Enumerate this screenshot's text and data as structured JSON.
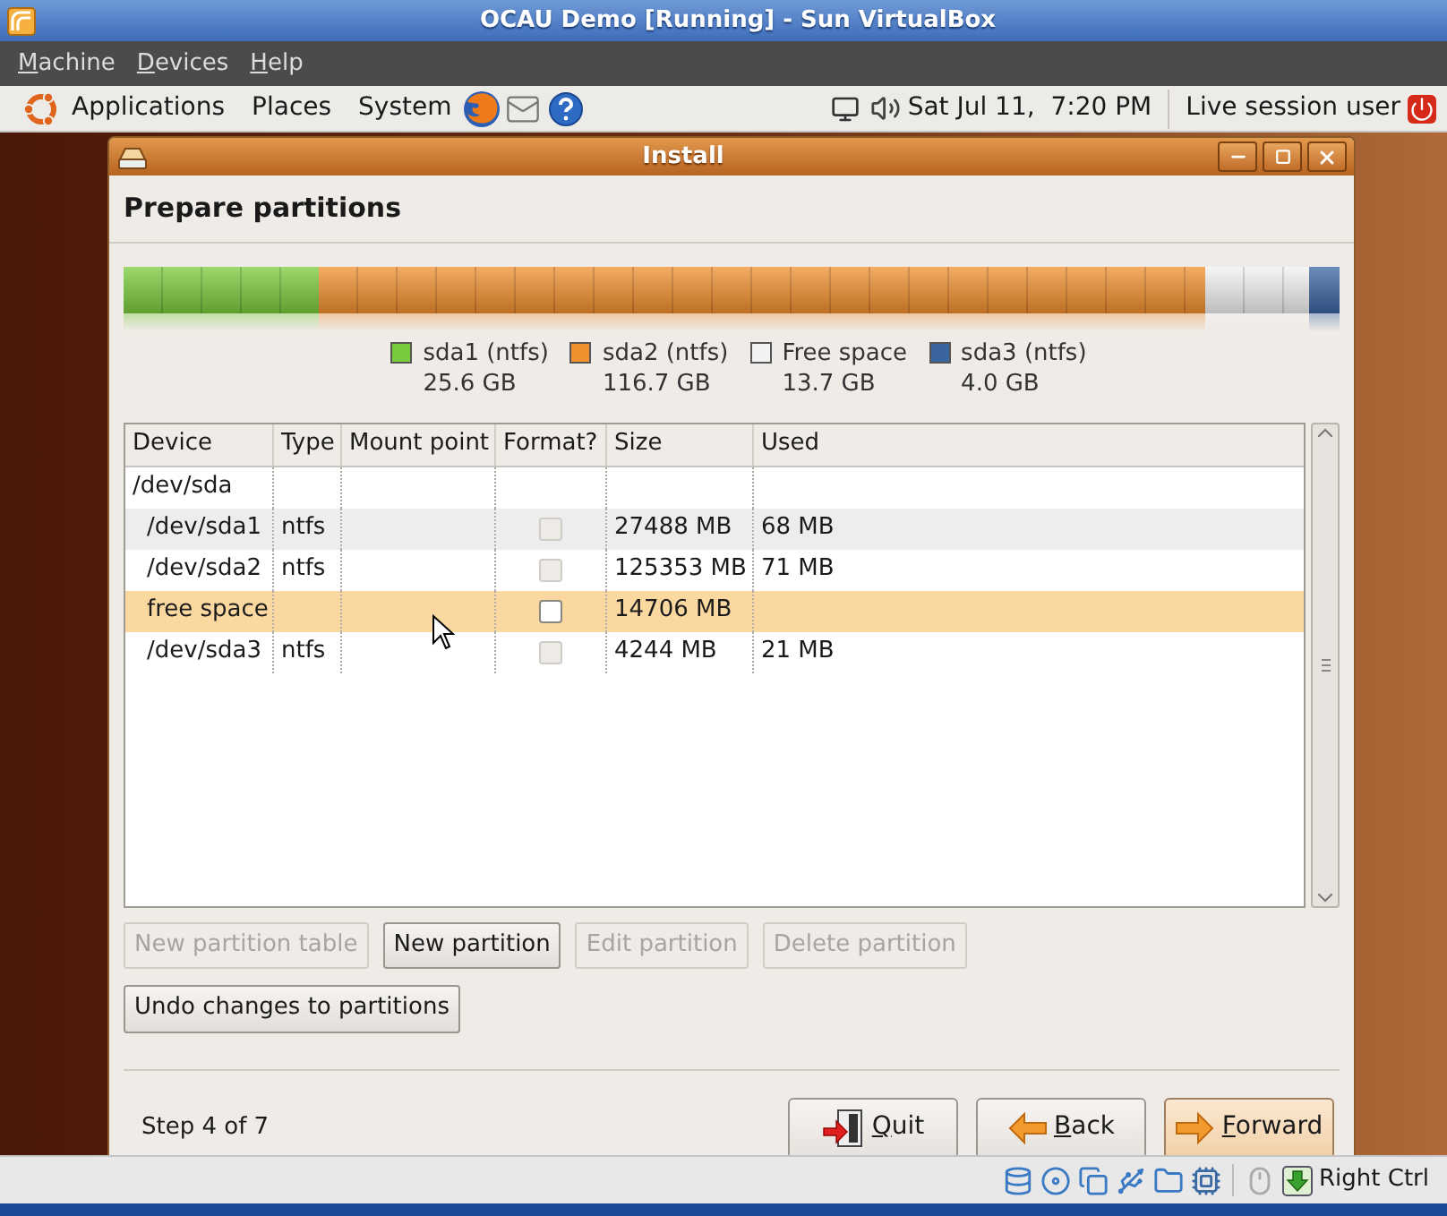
{
  "host_window": {
    "title": "OCAU Demo [Running] - Sun VirtualBox"
  },
  "host_menu": [
    {
      "label": "Machine"
    },
    {
      "label": "Devices"
    },
    {
      "label": "Help"
    }
  ],
  "guest_panel": {
    "menus": [
      "Applications",
      "Places",
      "System"
    ],
    "clock": "Sat Jul 11,  7:20 PM",
    "user": "Live session user"
  },
  "installer": {
    "title": "Install",
    "heading": "Prepare partitions",
    "partition_bar": [
      {
        "label": "sda1 (ntfs)",
        "size": "25.6 GB",
        "color": "#7acb3c"
      },
      {
        "label": "sda2 (ntfs)",
        "size": "116.7 GB",
        "color": "#f0902e"
      },
      {
        "label": "Free space",
        "size": "13.7 GB",
        "color": "#f2f2f2"
      },
      {
        "label": "sda3 (ntfs)",
        "size": "4.0 GB",
        "color": "#3a64a0"
      }
    ],
    "table": {
      "columns": [
        "Device",
        "Type",
        "Mount point",
        "Format?",
        "Size",
        "Used"
      ],
      "rows": [
        {
          "device": "/dev/sda",
          "selected": false,
          "children": [
            {
              "device": "/dev/sda1",
              "type": "ntfs",
              "format_checked": false,
              "format_disabled": true,
              "size": "27488 MB",
              "used": "68 MB",
              "selected": false
            },
            {
              "device": "/dev/sda2",
              "type": "ntfs",
              "format_checked": false,
              "format_disabled": true,
              "size": "125353 MB",
              "used": "71 MB",
              "selected": false
            },
            {
              "device": "free space",
              "format_checked": false,
              "format_disabled": false,
              "size": "14706 MB",
              "selected": true
            },
            {
              "device": "/dev/sda3",
              "type": "ntfs",
              "format_checked": false,
              "format_disabled": true,
              "size": "4244 MB",
              "used": "21 MB",
              "selected": false
            }
          ]
        }
      ]
    },
    "partition_buttons": [
      {
        "label": "New partition table",
        "disabled": true
      },
      {
        "label": "New partition",
        "disabled": false
      },
      {
        "label": "Edit partition",
        "disabled": true
      },
      {
        "label": "Delete partition",
        "disabled": true
      }
    ],
    "undo_button": {
      "label": "Undo changes to partitions"
    },
    "step": "Step 4 of 7",
    "nav_buttons": [
      {
        "kind": "quit",
        "label": "Quit",
        "focused": false
      },
      {
        "kind": "back",
        "label": "Back",
        "focused": false
      },
      {
        "kind": "forward",
        "label": "Forward",
        "focused": true
      }
    ]
  },
  "status_bar": {
    "host_key": "Right Ctrl"
  }
}
